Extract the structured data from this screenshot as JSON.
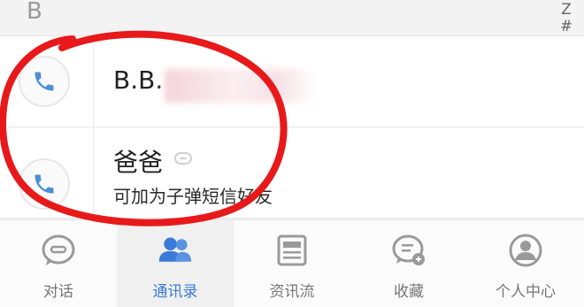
{
  "section": {
    "letter": "B"
  },
  "index_bar": [
    "Z",
    "#"
  ],
  "contacts": [
    {
      "name": "B.B.",
      "name_redacted": true,
      "call_icon": "phone-icon"
    },
    {
      "name": "爸爸",
      "badge_icon": "message-icon",
      "subtitle": "可加为子弹短信好友",
      "call_icon": "phone-icon"
    }
  ],
  "tabs": [
    {
      "label": "对话",
      "icon": "chat-icon",
      "active": false
    },
    {
      "label": "通讯录",
      "icon": "contacts-icon",
      "active": true
    },
    {
      "label": "资讯流",
      "icon": "news-icon",
      "active": false
    },
    {
      "label": "收藏",
      "icon": "favorites-icon",
      "active": false
    },
    {
      "label": "个人中心",
      "icon": "profile-icon",
      "active": false
    }
  ],
  "colors": {
    "accent": "#3a7ad8",
    "phone_icon": "#4a8fd8",
    "inactive_tab": "#9a9a9a",
    "annotation": "#e8191a"
  }
}
